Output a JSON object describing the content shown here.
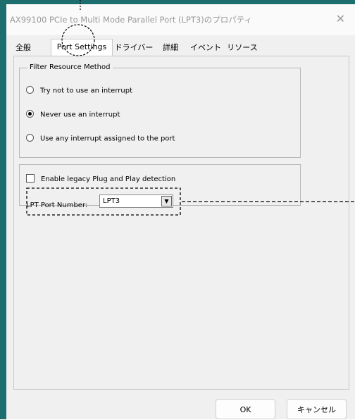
{
  "window": {
    "title": "AX99100 PCIe to Multi Mode Parallel Port (LPT3)のプロパティ",
    "close_glyph": "✕"
  },
  "tabs": [
    {
      "label": "全般"
    },
    {
      "label": "Port Settings"
    },
    {
      "label": "ドライバー"
    },
    {
      "label": "詳細"
    },
    {
      "label": "イベント"
    },
    {
      "label": "リソース"
    }
  ],
  "active_tab": "Port Settings",
  "filter_group": {
    "legend": "Filter Resource Method",
    "options": [
      {
        "label": "Try not to use an interrupt",
        "selected": false
      },
      {
        "label": "Never use an interrupt",
        "selected": true
      },
      {
        "label": "Use any interrupt assigned to the port",
        "selected": false
      }
    ]
  },
  "lpt_group": {
    "legacy_label": "Enable legacy Plug and Play detection",
    "legacy_checked": false,
    "port_number_label": "LPT Port Number:",
    "port_number_value": "LPT3",
    "dropdown_glyph": "▼"
  },
  "buttons": {
    "ok": "OK",
    "cancel": "キャンセル"
  },
  "colors": {
    "frame": "#1d6e6e",
    "dialog_bg": "#f0f0f0",
    "title_text": "#9a9a9a"
  }
}
